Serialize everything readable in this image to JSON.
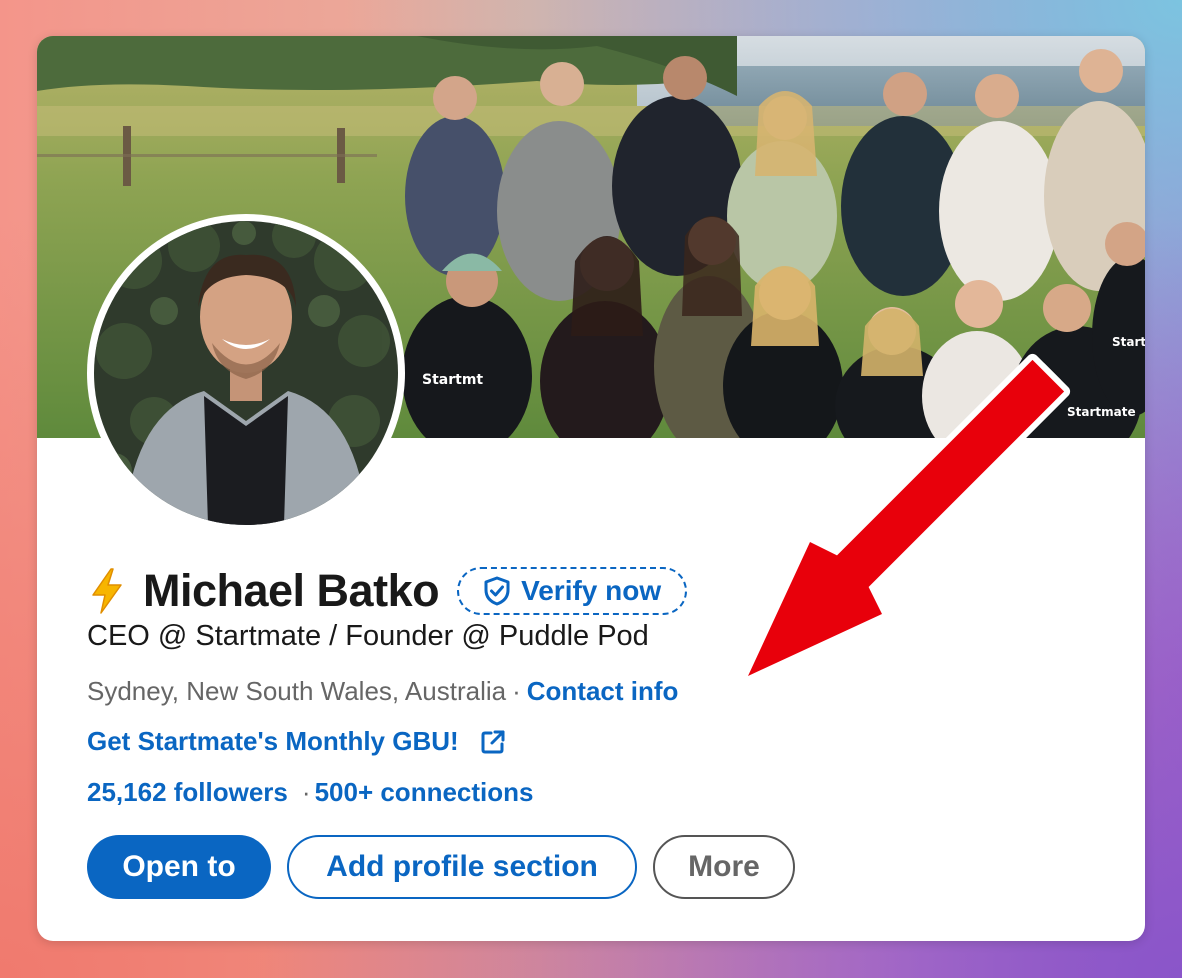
{
  "profile": {
    "name_emoji": "⚡",
    "name": "Michael Batko",
    "verify_label": "Verify now",
    "headline": "CEO @ Startmate / Founder @ Puddle Pod",
    "location": "Sydney, New South Wales, Australia",
    "location_separator": "·",
    "contact_info_label": "Contact info",
    "website_label": "Get Startmate's Monthly GBU!",
    "followers_label": "25,162 followers",
    "stats_separator": "·",
    "connections_label": "500+ connections"
  },
  "actions": {
    "open_to_label": "Open to",
    "add_section_label": "Add profile section",
    "more_label": "More"
  },
  "colors": {
    "linkedin_blue": "#0a66c2",
    "annotation_arrow": "#e8000b",
    "text_primary": "#191919",
    "text_secondary": "#666666"
  },
  "icons": {
    "verify": "shield-check-icon",
    "website": "external-link-icon",
    "name_emoji": "lightning-bolt-icon"
  },
  "images": {
    "cover": "group photo of team outdoors on grassy coastal field",
    "avatar": "headshot of smiling man in grey blazer against foliage"
  }
}
